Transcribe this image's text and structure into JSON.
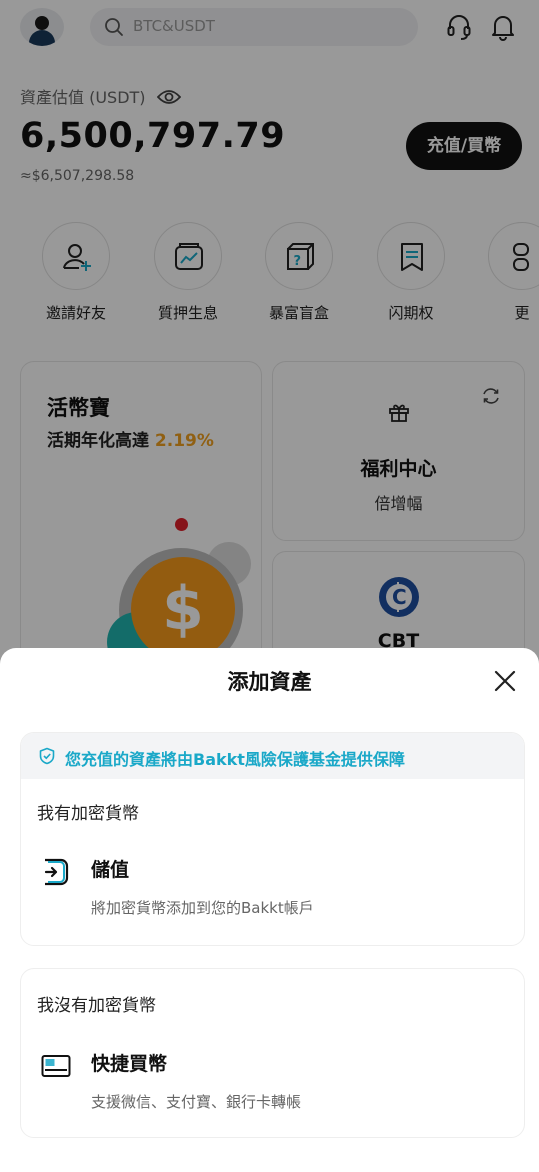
{
  "header": {
    "search_placeholder": "BTC&USDT"
  },
  "assets": {
    "label": "資產估值 (USDT)",
    "value": "6,500,797.79",
    "usd": "≈$6,507,298.58",
    "deposit_button": "充值/買幣"
  },
  "shortcuts": [
    {
      "label": "邀請好友",
      "icon": "add-user-icon"
    },
    {
      "label": "質押生息",
      "icon": "chart-wallet-icon"
    },
    {
      "label": "暴富盲盒",
      "icon": "mystery-box-icon"
    },
    {
      "label": "闪期权",
      "icon": "option-flag-icon"
    },
    {
      "label": "更",
      "icon": "more-icon"
    }
  ],
  "cards": {
    "savings": {
      "title": "活幣寶",
      "subtitle_prefix": "活期年化高達",
      "rate": "2.19%"
    },
    "welfare": {
      "title": "福利中心",
      "subtitle": "倍增幅"
    },
    "cbt": {
      "title": "CBT"
    }
  },
  "sheet": {
    "title": "添加資產",
    "notice": "您充值的資產將由Bakkt風險保護基金提供保障",
    "section1": {
      "heading": "我有加密貨幣",
      "option_title": "儲值",
      "option_desc": "將加密貨幣添加到您的Bakkt帳戶"
    },
    "section2": {
      "heading": "我沒有加密貨幣",
      "option_title": "快捷買幣",
      "option_desc": "支援微信、支付寶、銀行卡轉帳"
    }
  },
  "colors": {
    "accent_cyan": "#1aa8c8",
    "rate_orange": "#f0a020",
    "coin_orange": "#f59a1b",
    "cbt_blue": "#1e4fa0"
  }
}
